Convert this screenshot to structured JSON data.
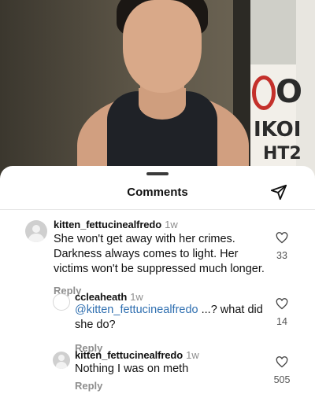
{
  "sheet": {
    "title": "Comments",
    "share_icon": "paper-plane-icon"
  },
  "comments": [
    {
      "username": "kitten_fettucinealfredo",
      "time": "1w",
      "text_lines": [
        "She won't get away with her crimes.",
        "Darkness always comes to light. Her",
        "victims won't be suppressed much longer."
      ],
      "reply_label": "Reply",
      "likes": "33"
    },
    {
      "username": "ccleaheath",
      "time": "1w",
      "mention": "@kitten_fettucinealfredo",
      "text_after_mention": " ...? what did",
      "text_line2": "she do?",
      "reply_label": "Reply",
      "likes": "14"
    },
    {
      "username": "kitten_fettucinealfredo",
      "time": "1w",
      "text_lines": [
        "Nothing I was on meth"
      ],
      "reply_label": "Reply",
      "likes": "505"
    }
  ],
  "background_sign": {
    "lines": [
      "O",
      "IKOI",
      "HT2"
    ]
  },
  "colors": {
    "mention": "#2f6fb0",
    "muted": "#8e8e8e",
    "sheet": "#ffffff"
  }
}
